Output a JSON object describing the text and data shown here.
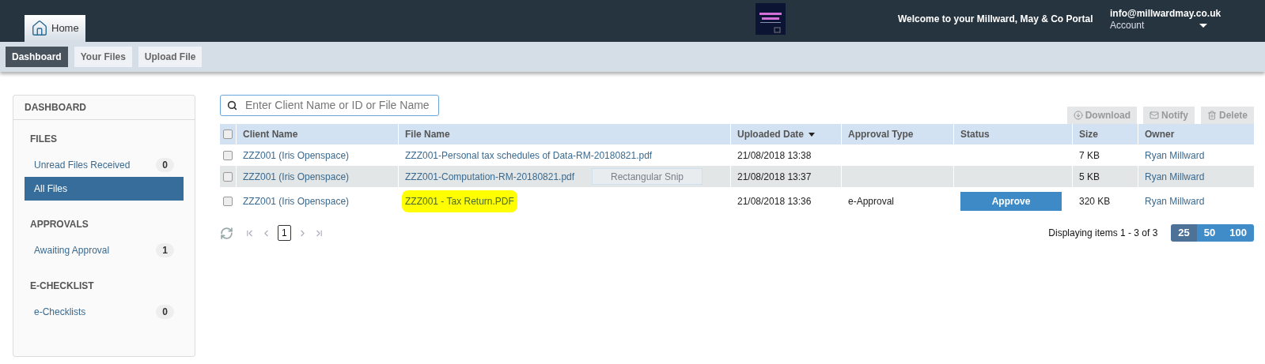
{
  "header": {
    "home_tab": {
      "label": "Home",
      "selected": true
    },
    "welcome": "Welcome to your Millward, May & Co Portal",
    "email": "info@millwardmay.co.uk",
    "account": "Account"
  },
  "subnav": [
    {
      "label": "Dashboard",
      "selected": true
    },
    {
      "label": "Your Files",
      "selected": false
    },
    {
      "label": "Upload File",
      "selected": false
    }
  ],
  "sidebar": {
    "title": "DASHBOARD",
    "sections": [
      {
        "heading": "FILES",
        "items": [
          {
            "label": "Unread Files Received",
            "count": "0",
            "selected": false
          },
          {
            "label": "All Files",
            "selected": true
          }
        ]
      },
      {
        "heading": "APPROVALS",
        "items": [
          {
            "label": "Awaiting Approval",
            "count": "1",
            "selected": false
          }
        ]
      },
      {
        "heading": "E-CHECKLIST",
        "items": [
          {
            "label": "e-Checklists",
            "count": "0",
            "selected": false
          }
        ]
      }
    ]
  },
  "search": {
    "placeholder": "Enter Client Name or ID or File Name"
  },
  "actions": [
    {
      "label": "Download",
      "kind": "download",
      "disabled": true
    },
    {
      "label": "Notify",
      "kind": "notify",
      "disabled": true
    },
    {
      "label": "Delete",
      "kind": "delete",
      "disabled": true
    }
  ],
  "table": {
    "all_checked": false,
    "columns": [
      "Client Name",
      "File Name",
      "Uploaded Date",
      "Approval Type",
      "Status",
      "Size",
      "Owner"
    ],
    "rows": [
      {
        "checked": false,
        "hovered": false,
        "highlighted": false,
        "cells": [
          "ZZZ001 (Iris Openspace)",
          "ZZZ001-Personal tax schedules of Data-RM-20180821.pdf",
          "21/08/2018 13:38",
          "",
          "",
          "7 KB",
          "Ryan Millward"
        ]
      },
      {
        "checked": false,
        "hovered": true,
        "highlighted": false,
        "cells": [
          "ZZZ001 (Iris Openspace)",
          "ZZZ001-Computation-RM-20180821.pdf",
          "21/08/2018 13:37",
          "",
          "",
          "5 KB",
          "Ryan Millward"
        ]
      },
      {
        "checked": false,
        "hovered": false,
        "highlighted": true,
        "cells": [
          "ZZZ001 (Iris Openspace)",
          "ZZZ001 - Tax Return.PDF",
          "21/08/2018 13:36",
          "e-Approval",
          "Approve",
          "320 KB",
          "Ryan Millward"
        ]
      }
    ]
  },
  "tooltip": "Rectangular Snip",
  "pager": {
    "page": "1",
    "summary": "Displaying items 1 - 3 of 3",
    "sizes": [
      {
        "label": "25",
        "selected": true
      },
      {
        "label": "50",
        "selected": false
      },
      {
        "label": "100",
        "selected": false
      }
    ]
  }
}
